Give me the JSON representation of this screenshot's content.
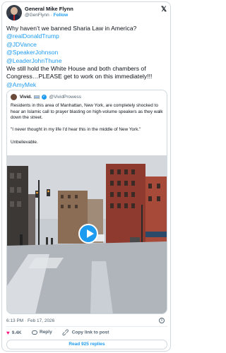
{
  "author": {
    "name": "General Mike Flynn",
    "handle": "@GenFlynn",
    "separator": "·",
    "follow_label": "Follow"
  },
  "tweet": {
    "line1": "Why haven’t we banned Sharia Law in America?",
    "mentions_top": [
      "@realDonaldTrump",
      "@JDVance",
      "@SpeakerJohnson",
      "@LeaderJohnThune"
    ],
    "line2": "We still hold the White House and both chambers of Congress…PLEASE get to work on this immediately!!!",
    "mention_bottom": "@AmyMek"
  },
  "quoted": {
    "name": "Vivid.",
    "handle": "@VividProwess",
    "paragraphs": [
      "Residents in this area of Manhattan, New York, are completely shocked to hear an Islamic call to prayer blasting on high-volume speakers as they walk down the street.",
      "\"I never thought in my life I'd hear this in the middle of New York.\"",
      "Unbelievable."
    ]
  },
  "meta": {
    "timestamp": "6:13 PM · Feb 17, 2026",
    "info_icon": "info-icon"
  },
  "actions": {
    "likes": "9.4K",
    "reply_label": "Reply",
    "copy_label": "Copy link to post"
  },
  "read_replies_label": "Read 925 replies",
  "colors": {
    "accent": "#1d9bf0",
    "like": "#f91880",
    "muted": "#536471",
    "border": "#cfd9de"
  },
  "icons": [
    "x-logo-icon",
    "verified-icon",
    "play-icon",
    "heart-icon",
    "reply-icon",
    "link-icon",
    "info-icon"
  ]
}
